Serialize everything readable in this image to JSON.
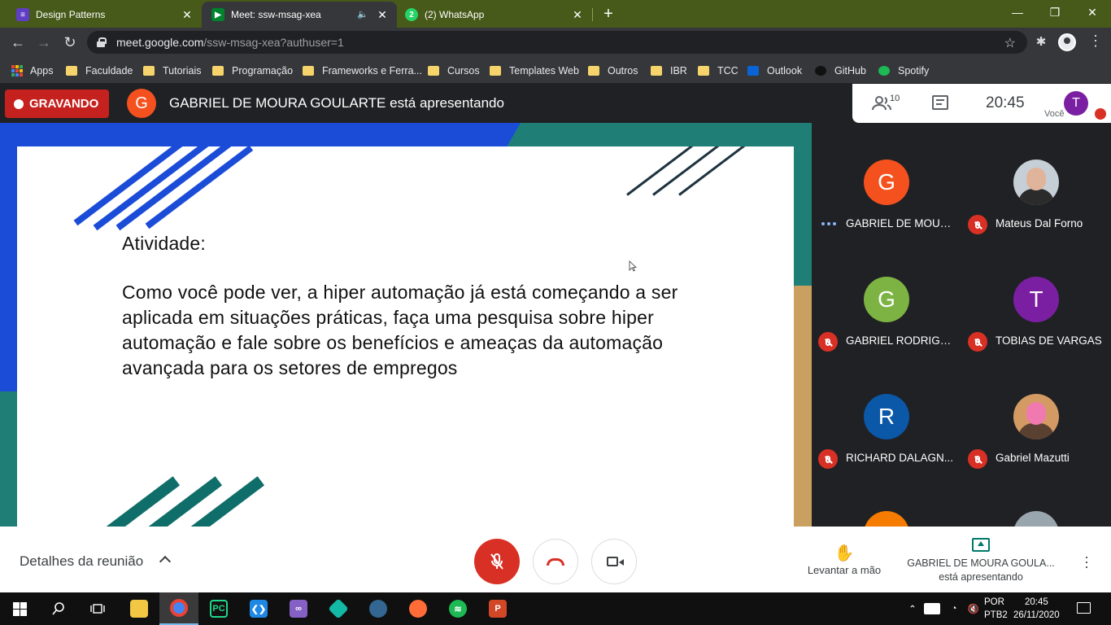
{
  "browser": {
    "tabs": [
      {
        "label": "Design Patterns",
        "favicon_color": "#5f3dc4",
        "active": false
      },
      {
        "label": "Meet: ssw-msag-xea",
        "favicon_color": "#00832d",
        "active": true
      },
      {
        "label": "(2) WhatsApp",
        "favicon_color": "#25d366",
        "active": false
      }
    ],
    "new_tab": "+",
    "url_host": "meet.google.com",
    "url_path": "/ssw-msag-xea?authuser=1",
    "bookmarks": [
      {
        "label": "Apps"
      },
      {
        "label": "Faculdade"
      },
      {
        "label": "Tutoriais"
      },
      {
        "label": "Programação"
      },
      {
        "label": "Frameworks e Ferra..."
      },
      {
        "label": "Cursos"
      },
      {
        "label": "Templates Web"
      },
      {
        "label": "Outros"
      },
      {
        "label": "IBR"
      },
      {
        "label": "TCC"
      },
      {
        "label": "Outlook"
      },
      {
        "label": "GitHub"
      },
      {
        "label": "Spotify"
      }
    ]
  },
  "meet": {
    "recording_label": "GRAVANDO",
    "presenter_initial": "G",
    "presenter_text": "GABRIEL DE MOURA GOULARTE está apresentando",
    "participant_count": "10",
    "time": "20:45",
    "self_initial": "T",
    "self_label": "Você",
    "slide": {
      "title": "Atividade:",
      "body": "Como você pode ver, a hiper automação já está começando a ser aplicada em situações práticas, faça uma pesquisa sobre hiper automação e fale sobre  os benefícios e ameaças da automação avançada para os setores de empregos"
    },
    "participants": [
      {
        "initial": "G",
        "name": "GABRIEL DE MOUR...",
        "color": "#f4511e",
        "state": "speaking"
      },
      {
        "initial": "",
        "name": "Mateus Dal Forno",
        "color": "#c7cfd6",
        "state": "muted",
        "photo": true
      },
      {
        "initial": "G",
        "name": "GABRIEL RODRIGU...",
        "color": "#7cb342",
        "state": "muted"
      },
      {
        "initial": "T",
        "name": "TOBIAS DE VARGAS",
        "color": "#7b1fa2",
        "state": "muted"
      },
      {
        "initial": "R",
        "name": "RICHARD DALAGN...",
        "color": "#0b57a8",
        "state": "muted"
      },
      {
        "initial": "",
        "name": "Gabriel Mazutti",
        "color": "#d39b63",
        "state": "muted",
        "photo": true
      }
    ],
    "details_label": "Detalhes da reunião",
    "raise_hand_label": "Levantar a mão",
    "presenting_name": "GABRIEL DE MOURA GOULA...",
    "presenting_suffix": "está apresentando"
  },
  "taskbar": {
    "apps": [
      {
        "name": "file-explorer",
        "color": "#f2c744"
      },
      {
        "name": "chrome",
        "color": "#4285f4"
      },
      {
        "name": "pycharm",
        "color": "#21d789"
      },
      {
        "name": "vscode",
        "color": "#1e88e5"
      },
      {
        "name": "visual-studio",
        "color": "#8661c5"
      },
      {
        "name": "git-kraken",
        "color": "#14b8a6"
      },
      {
        "name": "postgres",
        "color": "#336791"
      },
      {
        "name": "postman",
        "color": "#ff6c37"
      },
      {
        "name": "spotify",
        "color": "#1db954"
      },
      {
        "name": "powerpoint",
        "color": "#d24726"
      }
    ],
    "lang_top": "POR",
    "lang_bottom": "PTB2",
    "clock_time": "20:45",
    "clock_date": "26/11/2020"
  }
}
